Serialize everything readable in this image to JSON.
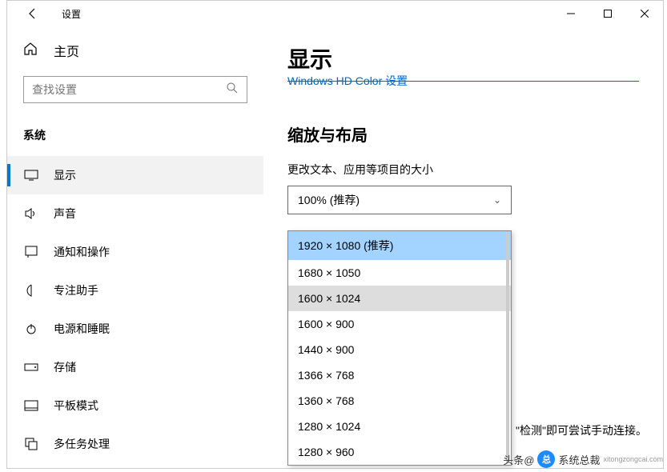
{
  "titlebar": {
    "title": "设置"
  },
  "sidebar": {
    "home": "主页",
    "search_placeholder": "查找设置",
    "category": "系统",
    "items": [
      {
        "label": "显示"
      },
      {
        "label": "声音"
      },
      {
        "label": "通知和操作"
      },
      {
        "label": "专注助手"
      },
      {
        "label": "电源和睡眠"
      },
      {
        "label": "存储"
      },
      {
        "label": "平板模式"
      },
      {
        "label": "多任务处理"
      }
    ]
  },
  "main": {
    "title": "显示",
    "link": "Windows HD Color 设置",
    "section": "缩放与布局",
    "scale_label": "更改文本、应用等项目的大小",
    "scale_value": "100% (推荐)",
    "res_options": [
      "1920 × 1080 (推荐)",
      "1680 × 1050",
      "1600 × 1024",
      "1600 × 900",
      "1440 × 900",
      "1366 × 768",
      "1360 × 768",
      "1280 × 1024",
      "1280 × 960"
    ],
    "hint": "\"检测\"即可尝试手动连接。"
  },
  "watermark": {
    "prefix": "头条@",
    "brand": "系统总裁",
    "url": "xitongzongcai.com"
  }
}
